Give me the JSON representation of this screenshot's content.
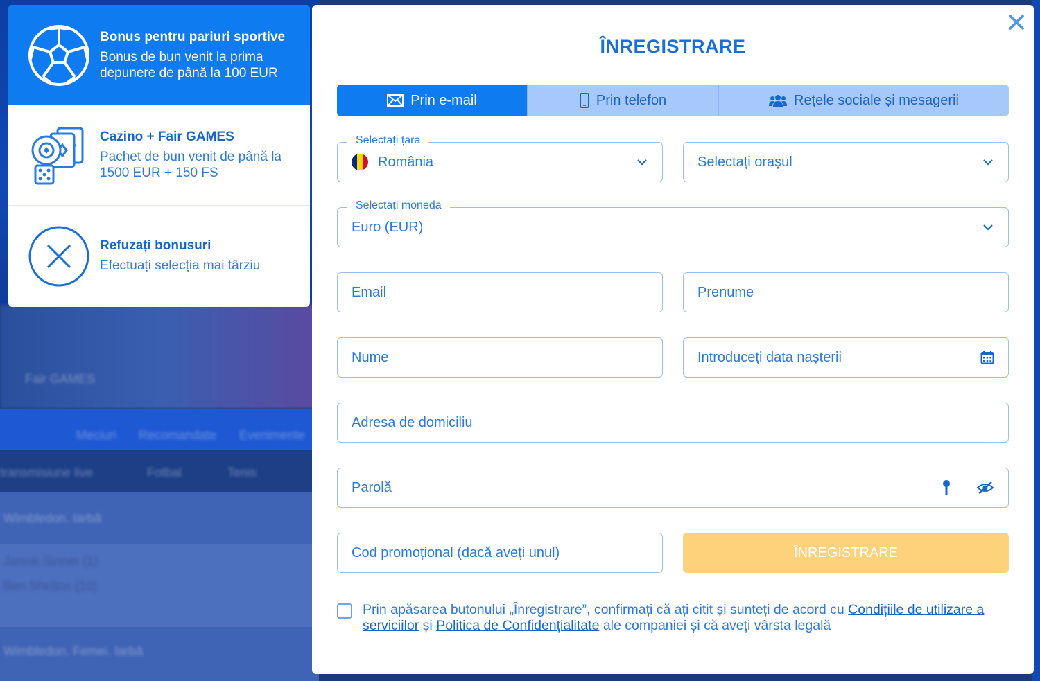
{
  "background": {
    "ghost_texts": [
      "Fair GAMES",
      "Meciuri",
      "Recomandate",
      "Evenimente",
      "transmisiune live",
      "Fotbal",
      "Tenis",
      "Wimbledon. Iarbă",
      "Jannik Sinner (1)",
      "Ben Shelton (10)",
      "Wimbledon. Femei. Iarbă"
    ]
  },
  "bonus": {
    "items": [
      {
        "title": "Bonus pentru pariuri sportive",
        "desc_line1": "Bonus de bun venit la prima",
        "desc_line2": "depunere de până la 100 EUR",
        "icon": "soccer-ball-icon",
        "active": true
      },
      {
        "title": "Cazino + Fair GAMES",
        "desc_line1": "Pachet de bun venit de până la",
        "desc_line2": "1500 EUR + 150 FS",
        "icon": "casino-chips-cards-icon",
        "active": false
      },
      {
        "title": "Refuzați bonusuri",
        "desc_line1": "Efectuați selecția mai târziu",
        "desc_line2": "",
        "icon": "decline-x-icon",
        "active": false
      }
    ]
  },
  "modal": {
    "title": "ÎNREGISTRARE",
    "tabs": [
      {
        "label": "Prin e-mail",
        "icon": "envelope-icon",
        "active": true
      },
      {
        "label": "Prin telefon",
        "icon": "phone-icon",
        "active": false
      },
      {
        "label": "Rețele sociale și mesagerii",
        "icon": "users-icon",
        "active": false
      }
    ],
    "fields": {
      "country": {
        "legend": "Selectați țara",
        "value": "România"
      },
      "city": {
        "placeholder": "Selectați orașul"
      },
      "currency": {
        "legend": "Selectați moneda",
        "value": "Euro (EUR)"
      },
      "email": {
        "placeholder": "Email"
      },
      "first_name": {
        "placeholder": "Prenume"
      },
      "last_name": {
        "placeholder": "Nume"
      },
      "birth_date": {
        "placeholder": "Introduceți data nașterii"
      },
      "address": {
        "placeholder": "Adresa de domiciliu"
      },
      "password": {
        "placeholder": "Parolă"
      },
      "promo": {
        "placeholder": "Cod promoțional (dacă aveți unul)"
      }
    },
    "submit_label": "ÎNREGISTRARE",
    "terms": {
      "text_before": "Prin apăsarea butonului „Înregistrare”, confirmați că ați citit și sunteți de acord cu ",
      "link1": "Condițiile de utilizare a serviciilor",
      "text_mid": " și ",
      "link2": "Politica de Confidențialitate",
      "text_after": " ale companiei și că aveți vârsta legală"
    }
  },
  "colors": {
    "primary": "#0f7bf0",
    "text_blue": "#2a7be0",
    "tab_inactive": "#a7c8fa",
    "submit_disabled": "#fdd27a",
    "flag_ro": [
      "#002b7f",
      "#fcd116",
      "#ce1126"
    ]
  }
}
